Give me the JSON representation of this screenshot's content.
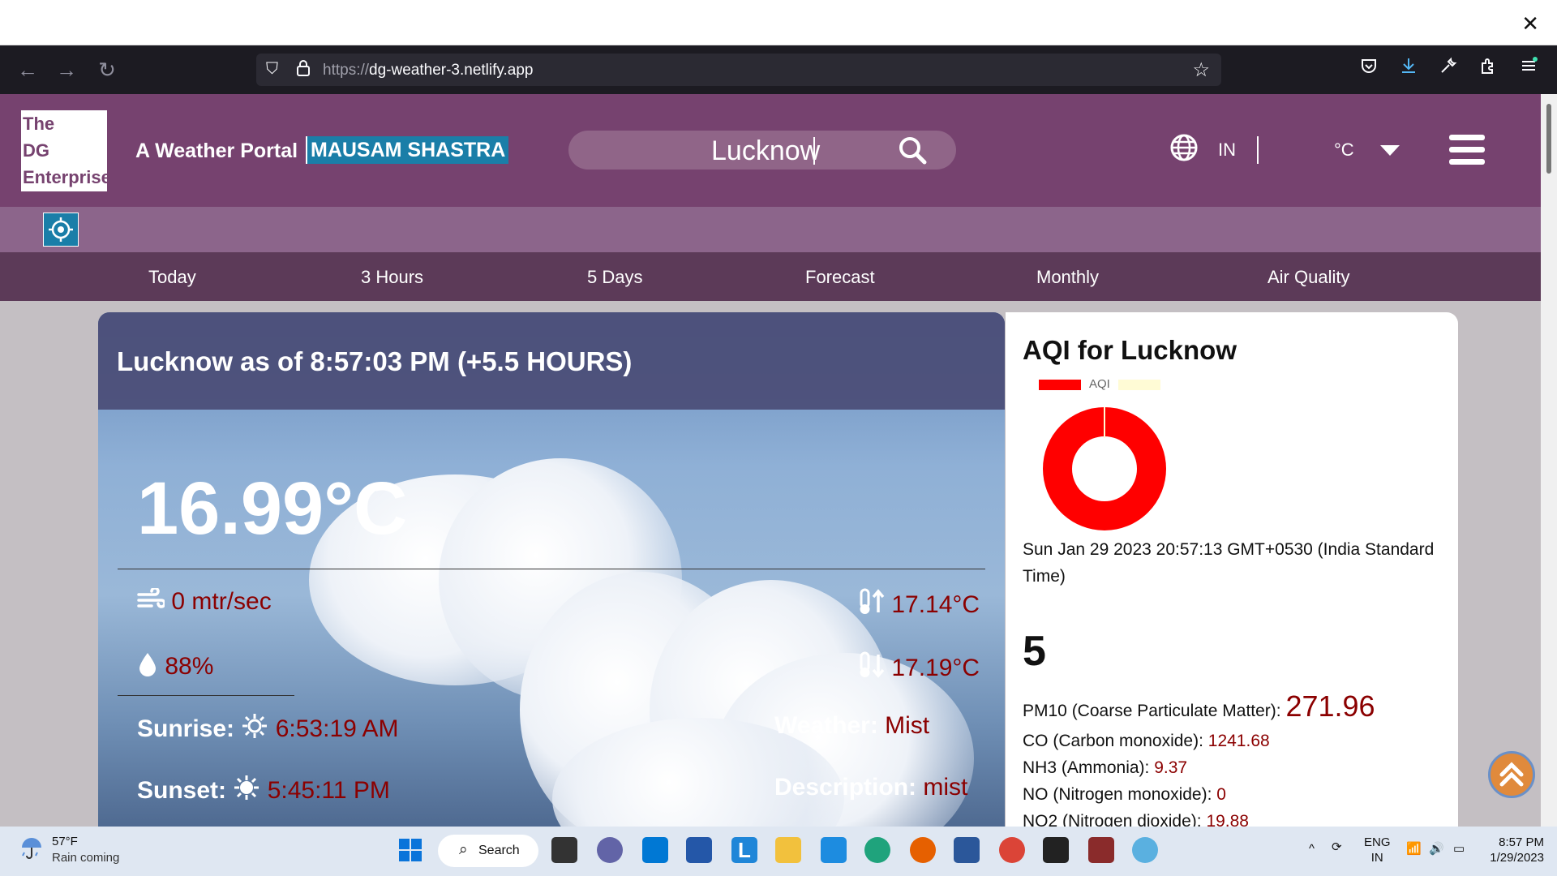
{
  "browser": {
    "url_protocol": "https://",
    "url_host": "dg-weather-3.netlify.app"
  },
  "header": {
    "logo_lines": [
      "The",
      "DG",
      "Enterprise"
    ],
    "portal_label": "A Weather Portal",
    "brand": "MAUSAM SHASTRA",
    "search_value": "Lucknow",
    "country": "IN",
    "unit": "°C"
  },
  "nav": {
    "tabs": [
      "Today",
      "3 Hours",
      "5 Days",
      "Forecast",
      "Monthly",
      "Air Quality"
    ]
  },
  "current": {
    "heading": "Lucknow as of 8:57:03 PM (+5.5 HOURS)",
    "temperature": "16.99°C",
    "wind": "0 mtr/sec",
    "humidity": "88%",
    "temp_max": "17.14°C",
    "temp_min": "17.19°C",
    "sunrise_label": "Sunrise:",
    "sunrise": "6:53:19 AM",
    "sunset_label": "Sunset:",
    "sunset": "5:45:11 PM",
    "weather_label": "Weather:",
    "weather": "Mist",
    "description_label": "Description:",
    "description": "mist"
  },
  "aqi": {
    "title": "AQI for Lucknow",
    "legend_label": "AQI",
    "date": "Sun Jan 29 2023 20:57:13 GMT+0530 (India Standard Time)",
    "value": "5",
    "pollutants": [
      {
        "label": "PM10 (Coarse Particulate Matter):",
        "value": "271.96"
      },
      {
        "label": "CO (Carbon monoxide):",
        "value": "1241.68"
      },
      {
        "label": "NH3 (Ammonia):",
        "value": "9.37"
      },
      {
        "label": "NO (Nitrogen monoxide):",
        "value": "0"
      },
      {
        "label": "NO2 (Nitrogen dioxide):",
        "value": "19.88"
      }
    ],
    "colors": {
      "primary": "#ff0000",
      "secondary": "#fffbd5"
    }
  },
  "taskbar": {
    "weather_temp": "57°F",
    "weather_text": "Rain coming",
    "search_label": "Search",
    "lang_line1": "ENG",
    "lang_line2": "IN",
    "time": "8:57 PM",
    "date": "1/29/2023"
  }
}
